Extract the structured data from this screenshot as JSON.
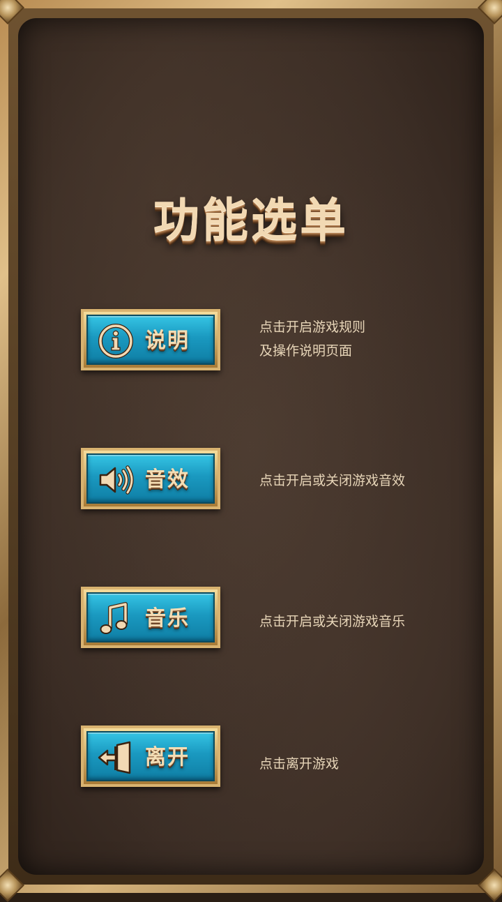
{
  "title": "功能选单",
  "menu": [
    {
      "id": "rules",
      "label": "说明",
      "icon": "info-icon",
      "desc": [
        "点击开启游戏规则",
        "及操作说明页面"
      ]
    },
    {
      "id": "sfx",
      "label": "音效",
      "icon": "speaker-icon",
      "desc": [
        "点击开启或关闭游戏音效"
      ]
    },
    {
      "id": "music",
      "label": "音乐",
      "icon": "music-note-icon",
      "desc": [
        "点击开启或关闭游戏音乐"
      ]
    },
    {
      "id": "exit",
      "label": "离开",
      "icon": "exit-door-icon",
      "desc": [
        "点击离开游戏"
      ]
    }
  ],
  "colors": {
    "button_face": "#1a99c0",
    "button_border": "#d9b370",
    "title": "#f2d9b3",
    "panel": "#3a2c24"
  }
}
